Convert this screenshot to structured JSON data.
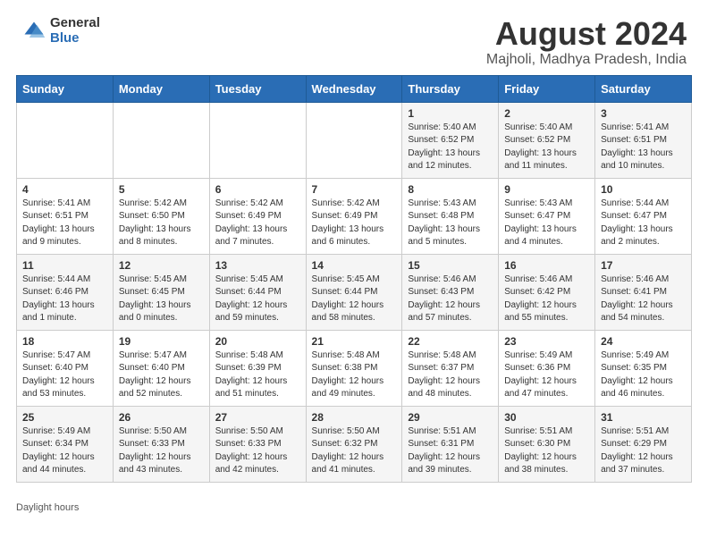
{
  "header": {
    "logo_general": "General",
    "logo_blue": "Blue",
    "main_title": "August 2024",
    "sub_title": "Majholi, Madhya Pradesh, India"
  },
  "calendar": {
    "weekdays": [
      "Sunday",
      "Monday",
      "Tuesday",
      "Wednesday",
      "Thursday",
      "Friday",
      "Saturday"
    ],
    "weeks": [
      [
        {
          "num": "",
          "info": ""
        },
        {
          "num": "",
          "info": ""
        },
        {
          "num": "",
          "info": ""
        },
        {
          "num": "",
          "info": ""
        },
        {
          "num": "1",
          "info": "Sunrise: 5:40 AM\nSunset: 6:52 PM\nDaylight: 13 hours\nand 12 minutes."
        },
        {
          "num": "2",
          "info": "Sunrise: 5:40 AM\nSunset: 6:52 PM\nDaylight: 13 hours\nand 11 minutes."
        },
        {
          "num": "3",
          "info": "Sunrise: 5:41 AM\nSunset: 6:51 PM\nDaylight: 13 hours\nand 10 minutes."
        }
      ],
      [
        {
          "num": "4",
          "info": "Sunrise: 5:41 AM\nSunset: 6:51 PM\nDaylight: 13 hours\nand 9 minutes."
        },
        {
          "num": "5",
          "info": "Sunrise: 5:42 AM\nSunset: 6:50 PM\nDaylight: 13 hours\nand 8 minutes."
        },
        {
          "num": "6",
          "info": "Sunrise: 5:42 AM\nSunset: 6:49 PM\nDaylight: 13 hours\nand 7 minutes."
        },
        {
          "num": "7",
          "info": "Sunrise: 5:42 AM\nSunset: 6:49 PM\nDaylight: 13 hours\nand 6 minutes."
        },
        {
          "num": "8",
          "info": "Sunrise: 5:43 AM\nSunset: 6:48 PM\nDaylight: 13 hours\nand 5 minutes."
        },
        {
          "num": "9",
          "info": "Sunrise: 5:43 AM\nSunset: 6:47 PM\nDaylight: 13 hours\nand 4 minutes."
        },
        {
          "num": "10",
          "info": "Sunrise: 5:44 AM\nSunset: 6:47 PM\nDaylight: 13 hours\nand 2 minutes."
        }
      ],
      [
        {
          "num": "11",
          "info": "Sunrise: 5:44 AM\nSunset: 6:46 PM\nDaylight: 13 hours\nand 1 minute."
        },
        {
          "num": "12",
          "info": "Sunrise: 5:45 AM\nSunset: 6:45 PM\nDaylight: 13 hours\nand 0 minutes."
        },
        {
          "num": "13",
          "info": "Sunrise: 5:45 AM\nSunset: 6:44 PM\nDaylight: 12 hours\nand 59 minutes."
        },
        {
          "num": "14",
          "info": "Sunrise: 5:45 AM\nSunset: 6:44 PM\nDaylight: 12 hours\nand 58 minutes."
        },
        {
          "num": "15",
          "info": "Sunrise: 5:46 AM\nSunset: 6:43 PM\nDaylight: 12 hours\nand 57 minutes."
        },
        {
          "num": "16",
          "info": "Sunrise: 5:46 AM\nSunset: 6:42 PM\nDaylight: 12 hours\nand 55 minutes."
        },
        {
          "num": "17",
          "info": "Sunrise: 5:46 AM\nSunset: 6:41 PM\nDaylight: 12 hours\nand 54 minutes."
        }
      ],
      [
        {
          "num": "18",
          "info": "Sunrise: 5:47 AM\nSunset: 6:40 PM\nDaylight: 12 hours\nand 53 minutes."
        },
        {
          "num": "19",
          "info": "Sunrise: 5:47 AM\nSunset: 6:40 PM\nDaylight: 12 hours\nand 52 minutes."
        },
        {
          "num": "20",
          "info": "Sunrise: 5:48 AM\nSunset: 6:39 PM\nDaylight: 12 hours\nand 51 minutes."
        },
        {
          "num": "21",
          "info": "Sunrise: 5:48 AM\nSunset: 6:38 PM\nDaylight: 12 hours\nand 49 minutes."
        },
        {
          "num": "22",
          "info": "Sunrise: 5:48 AM\nSunset: 6:37 PM\nDaylight: 12 hours\nand 48 minutes."
        },
        {
          "num": "23",
          "info": "Sunrise: 5:49 AM\nSunset: 6:36 PM\nDaylight: 12 hours\nand 47 minutes."
        },
        {
          "num": "24",
          "info": "Sunrise: 5:49 AM\nSunset: 6:35 PM\nDaylight: 12 hours\nand 46 minutes."
        }
      ],
      [
        {
          "num": "25",
          "info": "Sunrise: 5:49 AM\nSunset: 6:34 PM\nDaylight: 12 hours\nand 44 minutes."
        },
        {
          "num": "26",
          "info": "Sunrise: 5:50 AM\nSunset: 6:33 PM\nDaylight: 12 hours\nand 43 minutes."
        },
        {
          "num": "27",
          "info": "Sunrise: 5:50 AM\nSunset: 6:33 PM\nDaylight: 12 hours\nand 42 minutes."
        },
        {
          "num": "28",
          "info": "Sunrise: 5:50 AM\nSunset: 6:32 PM\nDaylight: 12 hours\nand 41 minutes."
        },
        {
          "num": "29",
          "info": "Sunrise: 5:51 AM\nSunset: 6:31 PM\nDaylight: 12 hours\nand 39 minutes."
        },
        {
          "num": "30",
          "info": "Sunrise: 5:51 AM\nSunset: 6:30 PM\nDaylight: 12 hours\nand 38 minutes."
        },
        {
          "num": "31",
          "info": "Sunrise: 5:51 AM\nSunset: 6:29 PM\nDaylight: 12 hours\nand 37 minutes."
        }
      ]
    ]
  },
  "footer": {
    "label": "Daylight hours"
  }
}
